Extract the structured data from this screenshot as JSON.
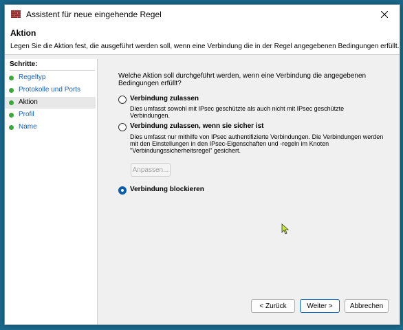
{
  "window": {
    "title": "Assistent für neue eingehende Regel",
    "close_icon": "close-icon"
  },
  "header": {
    "title": "Aktion",
    "description": "Legen Sie die Aktion fest, die ausgeführt werden soll, wenn eine Verbindung die in der Regel angegebenen Bedingungen erfüllt."
  },
  "sidebar": {
    "heading": "Schritte:",
    "steps": [
      {
        "label": "Regeltyp",
        "current": false
      },
      {
        "label": "Protokolle und Ports",
        "current": false
      },
      {
        "label": "Aktion",
        "current": true
      },
      {
        "label": "Profil",
        "current": false
      },
      {
        "label": "Name",
        "current": false
      }
    ]
  },
  "main": {
    "question": "Welche Aktion soll durchgeführt werden, wenn eine Verbindung die angegebenen Bedingungen erfüllt?",
    "options": [
      {
        "label": "Verbindung zulassen",
        "description": "Dies umfasst sowohl mit IPsec geschützte als auch nicht mit IPsec geschützte Verbindungen.",
        "selected": false
      },
      {
        "label": "Verbindung zulassen, wenn sie sicher ist",
        "description": "Dies umfasst nur mithilfe von IPsec authentifizierte Verbindungen. Die Verbindungen werden mit den Einstellungen in den IPsec-Eigenschaften und -regeln im Knoten \"Verbindungssicherheitsregel\" gesichert.",
        "selected": false
      },
      {
        "label": "Verbindung blockieren",
        "description": "",
        "selected": true
      }
    ],
    "customize_button": "Anpassen..."
  },
  "footer": {
    "back_button": "< Zurück",
    "next_button": "Weiter >",
    "cancel_button": "Abbrechen"
  },
  "colors": {
    "accent": "#0b5cad",
    "step_dot": "#3aa83a",
    "link": "#1a5fb4",
    "desktop": "#1b6a8e"
  }
}
